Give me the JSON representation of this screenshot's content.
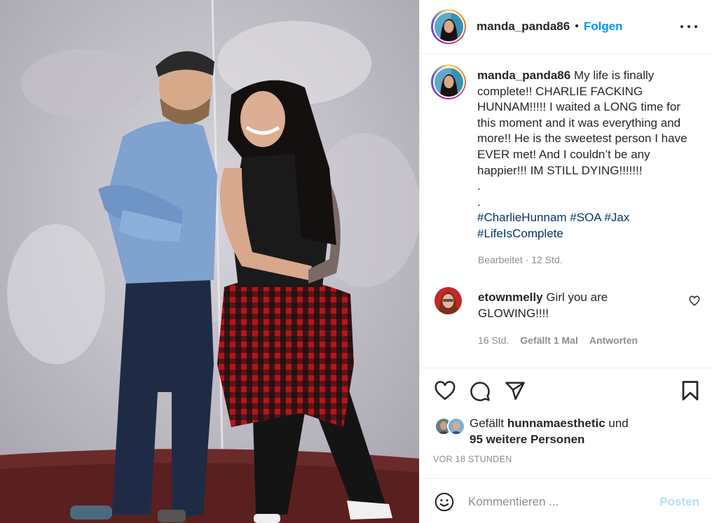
{
  "post": {
    "username": "manda_panda86",
    "follow_label": "Folgen",
    "dot": "•",
    "caption": {
      "username": "manda_panda86",
      "text": " My life is finally complete!! CHARLIE FACKING HUNNAM!!!!! I waited a LONG time for this moment and it was everything and more!! He is the sweetest person I have EVER met! And I couldn’t be any happier!!! IM STILL DYING!!!!!!!\n.\n.\n",
      "hashtags": "#CharlieHunnam #SOA #Jax\n#LifeIsComplete",
      "meta": "Bearbeitet · 12 Std."
    },
    "comments": [
      {
        "username": "etownmelly",
        "text": " Girl you are GLOWING!!!!",
        "time": "16 Std.",
        "likes": "Gefällt 1 Mal",
        "reply": "Antworten"
      }
    ],
    "likes": {
      "prefix": "Gefällt ",
      "user": "hunnamaesthetic",
      "middle": " und",
      "others": "95 weitere Personen"
    },
    "timestamp": "VOR 18 STUNDEN",
    "comment_input": {
      "placeholder": "Kommentieren ...",
      "post_label": "Posten"
    }
  },
  "icons": {
    "header_more": "more-options-icon",
    "like": "heart-icon",
    "comment": "comment-bubble-icon",
    "share": "paper-plane-icon",
    "save": "bookmark-icon",
    "emoji": "smiley-icon"
  },
  "colors": {
    "link": "#0095f6",
    "hashtag": "#00376b",
    "meta": "#8e8e8e",
    "post_disabled": "#b2dffc"
  }
}
